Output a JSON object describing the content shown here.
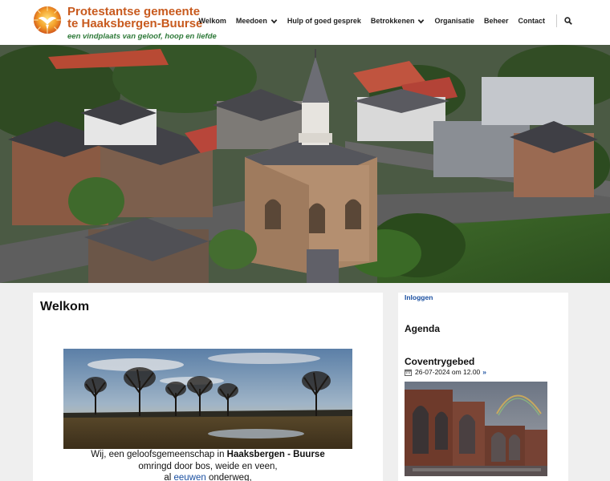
{
  "header": {
    "brand_line1": "Protestantse gemeente",
    "brand_line2": "te Haaksbergen-Buurse",
    "tagline": "een vindplaats van geloof, hoop en liefde",
    "brand_color": "#c85a1e",
    "tagline_color": "#2f7a3a"
  },
  "nav": {
    "items": [
      {
        "label": "Welkom",
        "dropdown": false
      },
      {
        "label": "Meedoen",
        "dropdown": true
      },
      {
        "label": "Hulp of goed gesprek",
        "dropdown": false
      },
      {
        "label": "Betrokkenen",
        "dropdown": true
      },
      {
        "label": "Organisatie",
        "dropdown": false
      },
      {
        "label": "Beheer",
        "dropdown": false
      },
      {
        "label": "Contact",
        "dropdown": false
      }
    ],
    "search_icon": "search-icon"
  },
  "main": {
    "title": "Welkom",
    "intro_prefix": "Wij, een geloofsgemeenschap in ",
    "intro_place": "Haaksbergen - Buurse",
    "intro_line2": "omringd door bos, weide en veen,",
    "intro_line3_prefix": "al ",
    "intro_link": "eeuwen",
    "intro_line3_suffix": " onderweg,"
  },
  "sidebar": {
    "login": "Inloggen",
    "agenda_title": "Agenda",
    "event": {
      "title": "Coventrygebed",
      "date": "26-07-2024 om 12.00",
      "more": "»"
    }
  },
  "colors": {
    "link": "#1a4fa0",
    "background": "#efefef"
  }
}
